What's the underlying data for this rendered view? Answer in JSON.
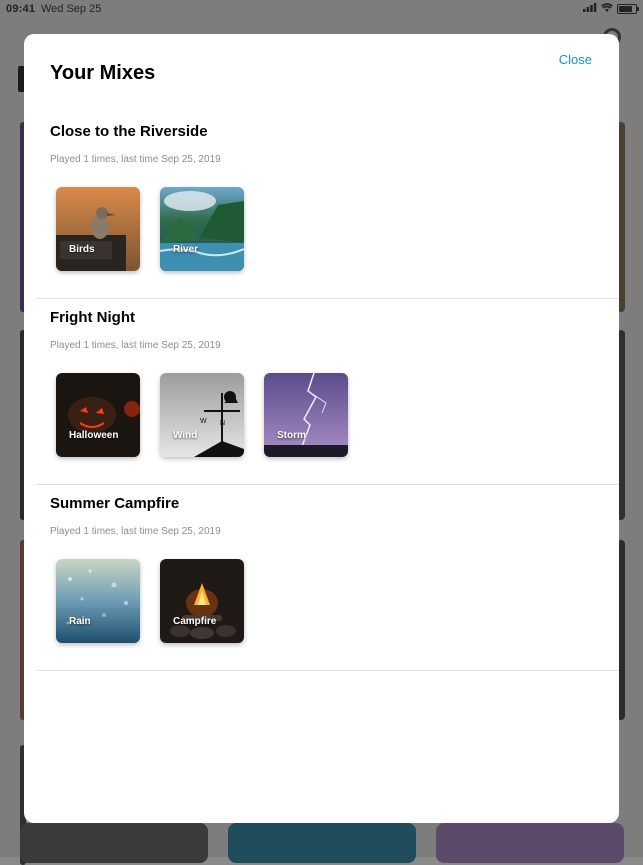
{
  "status_bar": {
    "time": "09:41",
    "date": "Wed Sep 25"
  },
  "sheet": {
    "title": "Your Mixes",
    "close_label": "Close"
  },
  "mixes": [
    {
      "title": "Close to the Riverside",
      "subtitle": "Played 1 times, last time Sep 25, 2019",
      "sounds": [
        {
          "label": "Birds"
        },
        {
          "label": "River"
        }
      ]
    },
    {
      "title": "Fright Night",
      "subtitle": "Played 1 times, last time Sep 25, 2019",
      "sounds": [
        {
          "label": "Halloween"
        },
        {
          "label": "Wind"
        },
        {
          "label": "Storm"
        }
      ]
    },
    {
      "title": "Summer Campfire",
      "subtitle": "Played 1 times, last time Sep 25, 2019",
      "sounds": [
        {
          "label": "Rain"
        },
        {
          "label": "Campfire"
        }
      ]
    }
  ],
  "colors": {
    "accent": "#1a8fd0",
    "subtitle": "#8e8e93",
    "divider": "#e2e2e2"
  }
}
